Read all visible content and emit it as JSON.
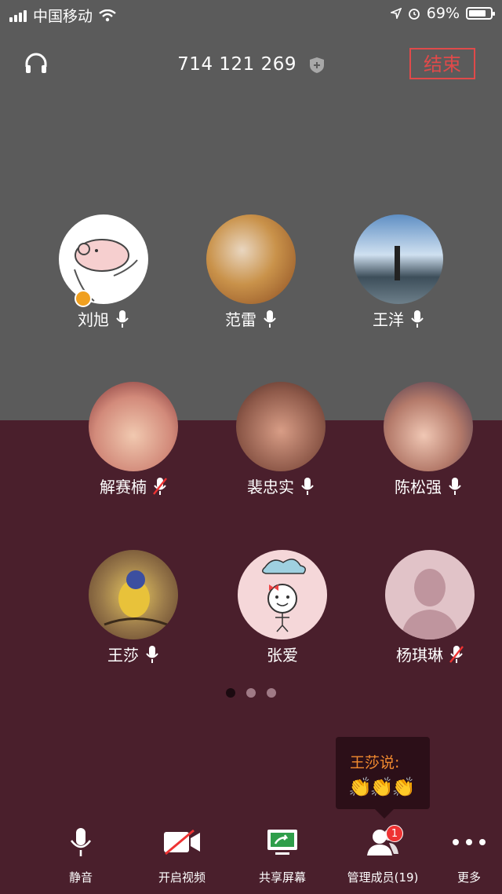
{
  "status_bar": {
    "carrier": "中国移动",
    "battery": "69%"
  },
  "header": {
    "meeting_id": "714 121 269",
    "end_button": "结束"
  },
  "participants": [
    {
      "name": "刘旭",
      "host": true,
      "muted": false
    },
    {
      "name": "范雷",
      "host": false,
      "muted": false
    },
    {
      "name": "王洋",
      "host": false,
      "muted": false
    },
    {
      "name": "解赛楠",
      "host": false,
      "muted": true
    },
    {
      "name": "裴忠实",
      "host": false,
      "muted": false
    },
    {
      "name": "陈松强",
      "host": false,
      "muted": false
    },
    {
      "name": "王莎",
      "host": false,
      "muted": false
    },
    {
      "name": "张爱",
      "host": false,
      "muted": null
    },
    {
      "name": "杨琪琳",
      "host": false,
      "muted": true
    }
  ],
  "pagination": {
    "pages": 3,
    "current": 1
  },
  "chat_popup": {
    "sender": "王莎说:",
    "message": "👏👏👏"
  },
  "toolbar": {
    "mute": "静音",
    "video": "开启视频",
    "share": "共享屏幕",
    "members": "管理成员(19)",
    "members_badge": "1",
    "more": "更多"
  },
  "colors": {
    "accent_red": "#e04a4a",
    "chat_name": "#f28a2f"
  }
}
